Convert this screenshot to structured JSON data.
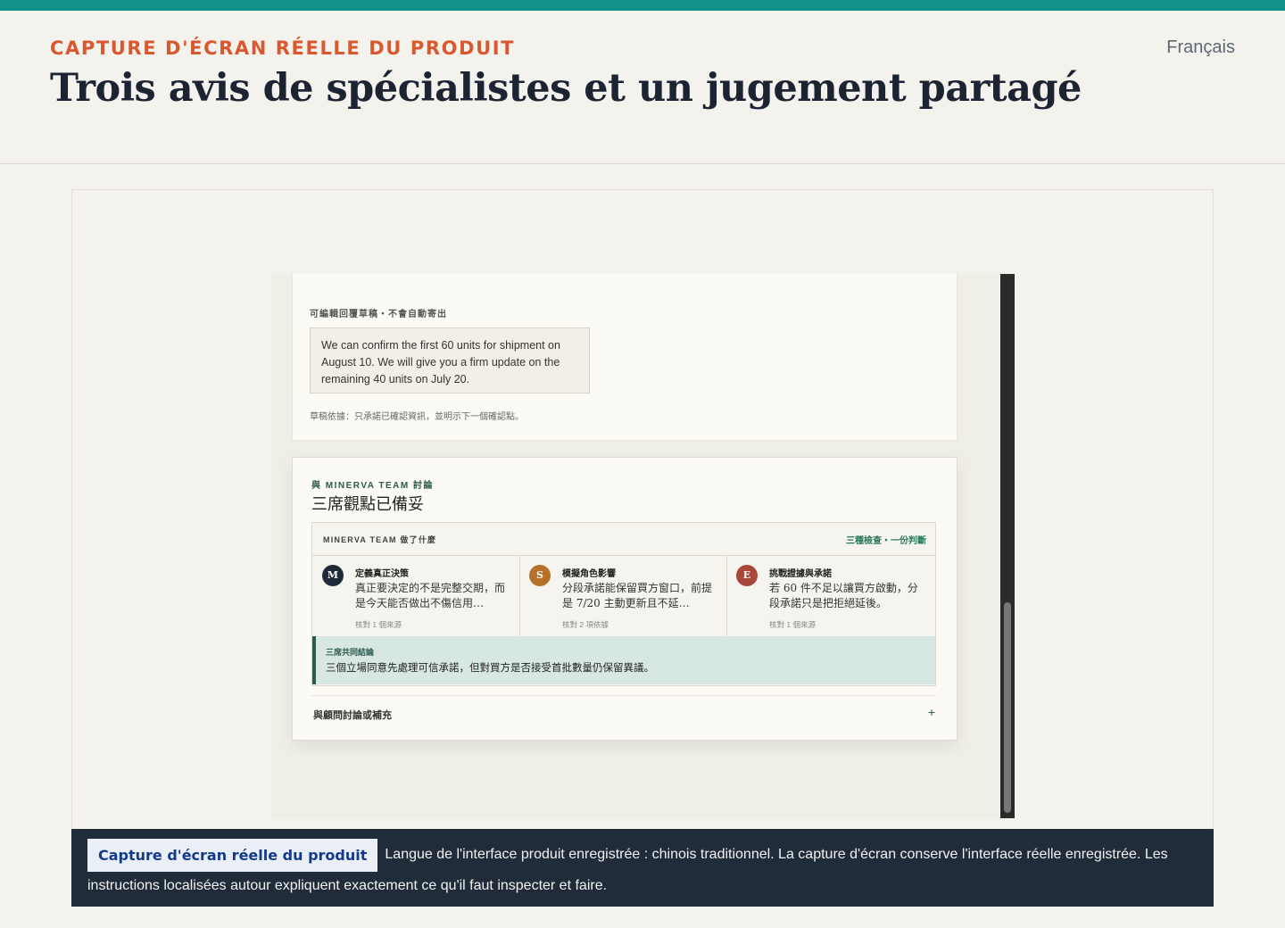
{
  "header": {
    "eyebrow": "CAPTURE D'ÉCRAN RÉELLE DU PRODUIT",
    "title": "Trois avis de spécialistes et un jugement partagé",
    "language": "Français"
  },
  "screenshot": {
    "draft": {
      "label": "可編輯回覆草稿・不會自動寄出",
      "text": "We can confirm the first 60 units for shipment on August 10. We will give you a firm update on the remaining 40 units on July 20.",
      "note": "草稿依據：只承諾已確認資訊，並明示下一個確認點。"
    },
    "card": {
      "eyebrow": "與 MINERVA TEAM 討論",
      "title": "三席觀點已備妥",
      "panel_label": "MINERVA TEAM 做了什麼",
      "panel_summary": "三種檢查・一份判斷",
      "columns": [
        {
          "avatar": "M",
          "color": "#1f2a38",
          "title": "定義真正決策",
          "body": "真正要決定的不是完整交期，而是今天能否做出不傷信用…",
          "meta": "核對 1 個來源"
        },
        {
          "avatar": "S",
          "color": "#b5712a",
          "title": "模擬角色影響",
          "body": "分段承諾能保留買方窗口，前提是 7/20 主動更新且不延…",
          "meta": "核對 2 項依據"
        },
        {
          "avatar": "E",
          "color": "#a9473b",
          "title": "挑戰證據與承諾",
          "body": "若 60 件不足以讓買方啟動，分段承諾只是把拒絕延後。",
          "meta": "核對 1 個來源"
        }
      ],
      "verdict_label": "三席共同結論",
      "verdict_text": "三個立場同意先處理可信承諾，但對買方是否接受首批數量仍保留異議。",
      "discuss_label": "與顧問討論或補充",
      "expand_icon": "plus-icon"
    }
  },
  "caption": {
    "badge": "Capture d'écran réelle du produit",
    "text": "Langue de l'interface produit enregistrée : chinois traditionnel. La capture d'écran conserve l'interface réelle enregistrée. Les instructions localisées autour expliquent exactement ce qu'il faut inspecter et faire."
  }
}
